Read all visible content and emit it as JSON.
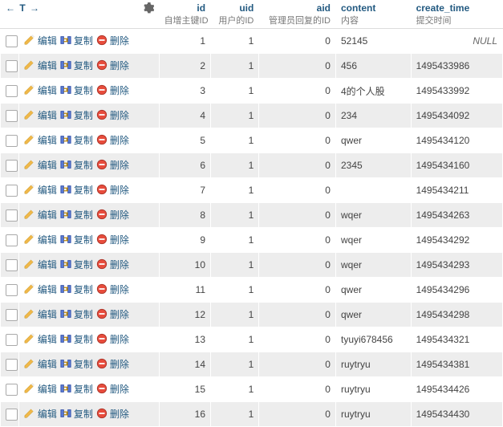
{
  "nav": {
    "left": "←",
    "t": "T",
    "right": "→"
  },
  "gear_title": "Options",
  "actions": {
    "edit": "编辑",
    "copy": "复制",
    "delete": "删除"
  },
  "columns": [
    {
      "key": "id",
      "label": "id",
      "sub": "自增主键ID",
      "align": "right"
    },
    {
      "key": "uid",
      "label": "uid",
      "sub": "用户的ID",
      "align": "right"
    },
    {
      "key": "aid",
      "label": "aid",
      "sub": "管理员回复的ID",
      "align": "right"
    },
    {
      "key": "content",
      "label": "content",
      "sub": "内容",
      "align": "left"
    },
    {
      "key": "create_time",
      "label": "create_time",
      "sub": "提交时间",
      "align": "left"
    }
  ],
  "rows": [
    {
      "id": 1,
      "uid": 1,
      "aid": 0,
      "content": "52145",
      "create_time": null
    },
    {
      "id": 2,
      "uid": 1,
      "aid": 0,
      "content": "456",
      "create_time": "1495433986"
    },
    {
      "id": 3,
      "uid": 1,
      "aid": 0,
      "content": "4的个人股",
      "create_time": "1495433992"
    },
    {
      "id": 4,
      "uid": 1,
      "aid": 0,
      "content": "234",
      "create_time": "1495434092"
    },
    {
      "id": 5,
      "uid": 1,
      "aid": 0,
      "content": "qwer",
      "create_time": "1495434120"
    },
    {
      "id": 6,
      "uid": 1,
      "aid": 0,
      "content": "2345",
      "create_time": "1495434160"
    },
    {
      "id": 7,
      "uid": 1,
      "aid": 0,
      "content": "",
      "create_time": "1495434211"
    },
    {
      "id": 8,
      "uid": 1,
      "aid": 0,
      "content": "wqer",
      "create_time": "1495434263"
    },
    {
      "id": 9,
      "uid": 1,
      "aid": 0,
      "content": "wqer",
      "create_time": "1495434292"
    },
    {
      "id": 10,
      "uid": 1,
      "aid": 0,
      "content": "wqer",
      "create_time": "1495434293"
    },
    {
      "id": 11,
      "uid": 1,
      "aid": 0,
      "content": "qwer",
      "create_time": "1495434296"
    },
    {
      "id": 12,
      "uid": 1,
      "aid": 0,
      "content": "qwer",
      "create_time": "1495434298"
    },
    {
      "id": 13,
      "uid": 1,
      "aid": 0,
      "content": "tyuyi678456",
      "create_time": "1495434321"
    },
    {
      "id": 14,
      "uid": 1,
      "aid": 0,
      "content": "ruytryu",
      "create_time": "1495434381"
    },
    {
      "id": 15,
      "uid": 1,
      "aid": 0,
      "content": "ruytryu",
      "create_time": "1495434426"
    },
    {
      "id": 16,
      "uid": 1,
      "aid": 0,
      "content": "ruytryu",
      "create_time": "1495434430"
    }
  ],
  "null_text": "NULL"
}
